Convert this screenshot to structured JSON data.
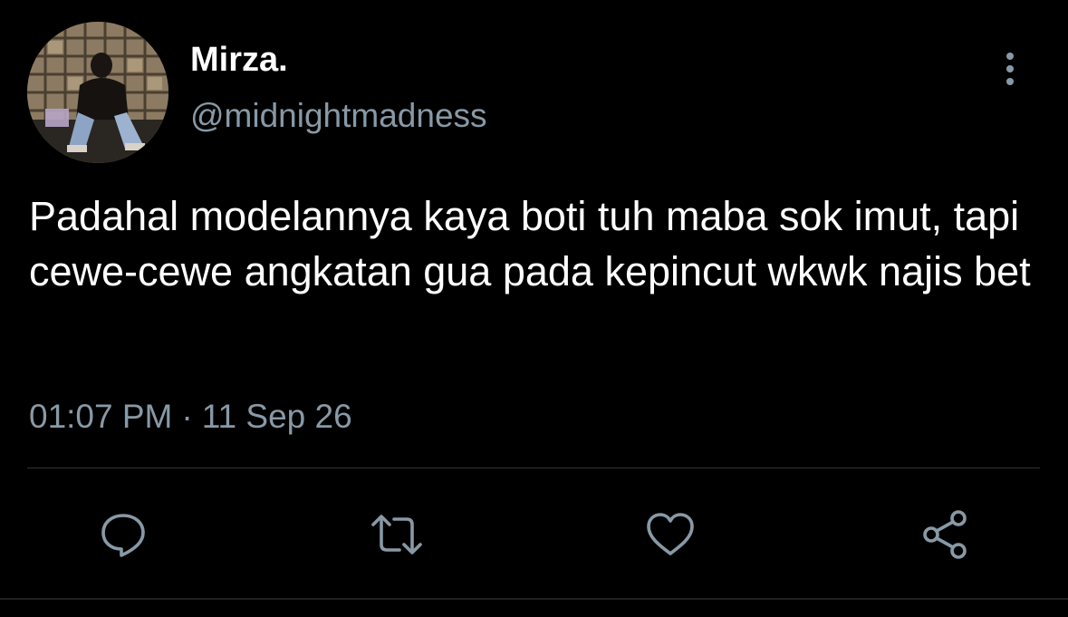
{
  "author": {
    "display_name": "Mirza.",
    "handle": "@midnightmadness",
    "avatar_icon": "profile-photo"
  },
  "tweet": {
    "text": "Padahal modelannya kaya boti tuh maba sok imut, tapi cewe-cewe angkatan gua pada kepincut wkwk najis bet",
    "time": "01:07 PM",
    "separator": "·",
    "date": "11 Sep 26"
  },
  "actions": [
    {
      "name": "reply",
      "icon": "comment-icon"
    },
    {
      "name": "retweet",
      "icon": "retweet-icon"
    },
    {
      "name": "like",
      "icon": "heart-icon"
    },
    {
      "name": "share",
      "icon": "share-icon"
    }
  ],
  "colors": {
    "background": "#000000",
    "text_primary": "#ffffff",
    "text_secondary": "#8899a6",
    "divider": "#2f3336"
  }
}
